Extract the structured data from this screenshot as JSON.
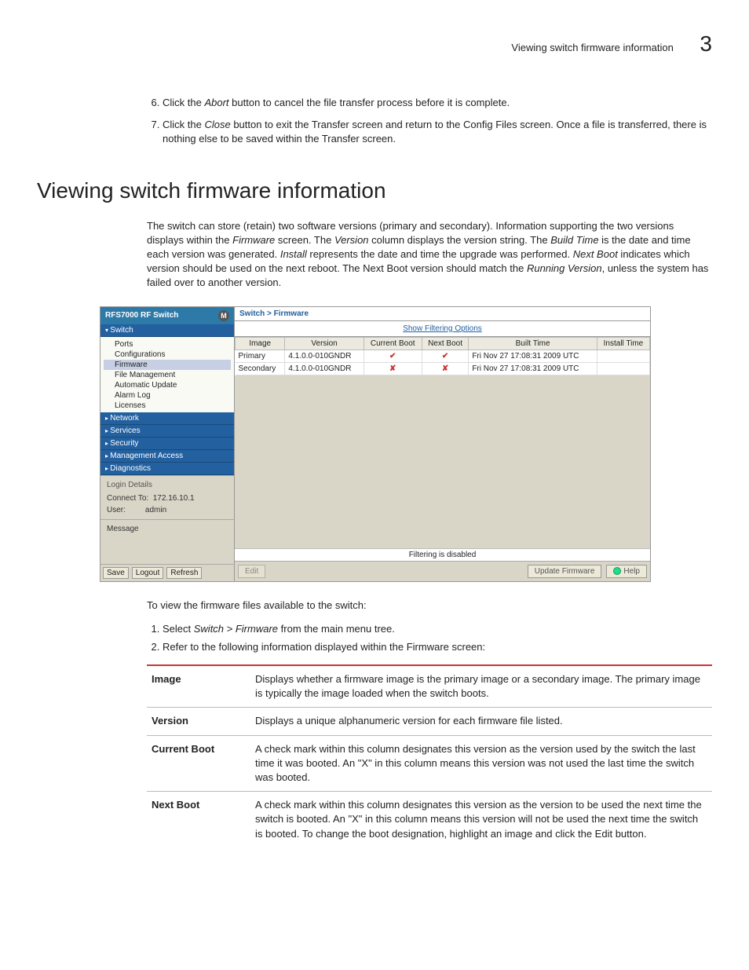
{
  "header": {
    "running_title": "Viewing switch firmware information",
    "chapter_number": "3"
  },
  "pre_steps": {
    "start": 6,
    "items": [
      {
        "pre": "Click the ",
        "em": "Abort",
        "post": " button to cancel the file transfer process before it is complete."
      },
      {
        "pre": "Click the ",
        "em": "Close",
        "post": " button to exit the Transfer screen and return to the Config Files screen. Once a file is transferred, there is nothing else to be saved within the Transfer screen."
      }
    ]
  },
  "section_title": "Viewing switch firmware information",
  "intro_parts": [
    "The switch can store (retain) two software versions (primary and secondary). Information supporting the two versions displays within the ",
    "Firmware",
    " screen. The ",
    "Version",
    " column displays the version string. The ",
    "Build Time",
    " is the date and time each version was generated. ",
    "Install",
    " represents the date and time the upgrade was performed. ",
    "Next Boot",
    " indicates which version should be used on the next reboot. The Next Boot version should match the ",
    "Running Version",
    ", unless the system has failed over to another version."
  ],
  "app": {
    "product": "RFS7000",
    "product_suffix": "RF Switch",
    "breadcrumb": "Switch > Firmware",
    "filter_link": "Show Filtering Options",
    "filter_status": "Filtering is disabled",
    "nav_sections": [
      "Switch",
      "Network",
      "Services",
      "Security",
      "Management Access",
      "Diagnostics"
    ],
    "tree_items": [
      "Ports",
      "Configurations",
      "Firmware",
      "File Management",
      "Automatic Update",
      "Alarm Log",
      "Licenses"
    ],
    "login": {
      "label": "Login Details",
      "connect_label": "Connect To:",
      "connect_val": "172.16.10.1",
      "user_label": "User:",
      "user_val": "admin"
    },
    "message_label": "Message",
    "left_buttons": [
      "Save",
      "Logout",
      "Refresh"
    ],
    "columns": [
      "Image",
      "Version",
      "Current Boot",
      "Next Boot",
      "Built Time",
      "Install Time"
    ],
    "rows": [
      {
        "image": "Primary",
        "version": "4.1.0.0-010GNDR",
        "current": "✔",
        "next": "✔",
        "built": "Fri Nov 27 17:08:31 2009 UTC",
        "install": ""
      },
      {
        "image": "Secondary",
        "version": "4.1.0.0-010GNDR",
        "current": "✘",
        "next": "✘",
        "built": "Fri Nov 27 17:08:31 2009 UTC",
        "install": ""
      }
    ],
    "main_buttons": {
      "edit": "Edit",
      "update": "Update Firmware",
      "help": "Help"
    }
  },
  "post_intro": "To view the firmware files available to the switch:",
  "post_steps": [
    {
      "pre": "Select ",
      "em": "Switch > Firmware",
      "post": " from the main menu tree."
    },
    {
      "pre": "Refer to the following information displayed within the Firmware screen:",
      "em": "",
      "post": ""
    }
  ],
  "defs": [
    {
      "term": "Image",
      "desc": "Displays whether a firmware image is the primary image or a secondary image. The primary image is typically the image loaded when the switch boots."
    },
    {
      "term": "Version",
      "desc": "Displays a unique alphanumeric version for each firmware file listed."
    },
    {
      "term": "Current Boot",
      "desc": "A check mark within this column designates this version as the version used by the switch the last time it was booted. An \"X\" in this column means this version was not used the last time the switch was booted."
    },
    {
      "term": "Next Boot",
      "desc": "A check mark within this column designates this version as the version to be used the next time the switch is booted. An \"X\" in this column means this version will not be used the next time the switch is booted. To change the boot designation, highlight an image and click the Edit button."
    }
  ]
}
